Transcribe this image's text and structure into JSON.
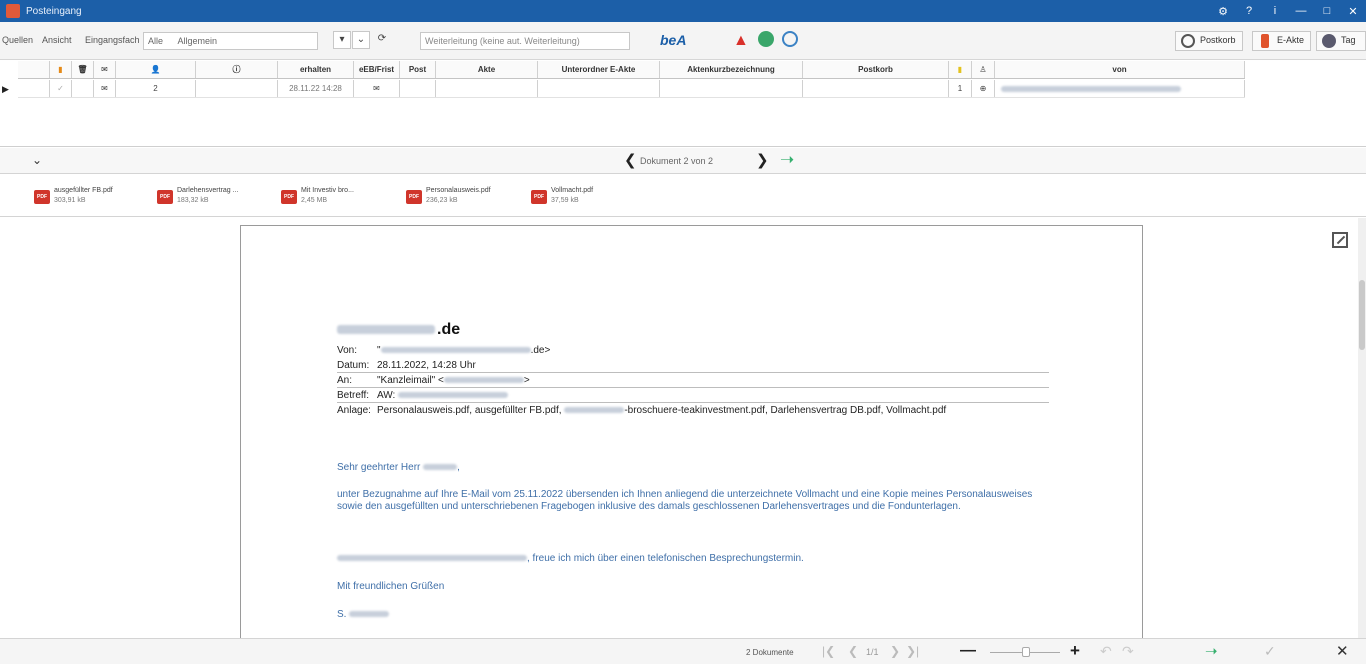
{
  "window": {
    "title": "Posteingang"
  },
  "titlebar_buttons": [
    "⚙",
    "?",
    "i",
    "—",
    "□",
    "✕"
  ],
  "toolbar": {
    "quellen": "Quellen",
    "ansicht": "Ansicht",
    "eingangsfach": "Eingangsfach",
    "fach_value": "Alle",
    "fach_select": "Allgemein",
    "weiterleitung": "Weiterleitung (keine aut. Weiterleitung)",
    "bea": "beA",
    "postkorb": "Postkorb",
    "eakte": "E-Akte",
    "tag": "Tag"
  },
  "grid": {
    "headers": [
      "",
      "",
      "",
      "",
      "",
      "erhalten",
      "eEB/Frist",
      "Post",
      "Akte",
      "Unterordner E-Akte",
      "Aktenkurzbezeichnung",
      "Postkorb",
      "",
      "",
      "von"
    ],
    "row": [
      "",
      "✓",
      "",
      "✉",
      "2",
      "",
      "28.11.22 14:28",
      "✉",
      "",
      "",
      "",
      "",
      "",
      "1",
      "⊕"
    ],
    "row_marker": "▶"
  },
  "pager": {
    "collapse": "⌄",
    "prev": "❮",
    "label": "Dokument 2 von 2",
    "next": "❯",
    "forward": "➝"
  },
  "attachments": [
    {
      "name": "ausgefüllter FB.pdf",
      "size": "303,91 kB"
    },
    {
      "name": "Darlehensvertrag ...",
      "size": "183,32 kB"
    },
    {
      "name": "Mit Investiv bro...",
      "size": "2,45 MB"
    },
    {
      "name": "Personalausweis.pdf",
      "size": "236,23 kB"
    },
    {
      "name": "Vollmacht.pdf",
      "size": "37,59 kB"
    }
  ],
  "attachment_icon": "PDF",
  "email": {
    "domain": ".de",
    "header_rows": [
      {
        "key": "Von:",
        "value_pre": "\"",
        "value_post": ".de>"
      },
      {
        "key": "Datum:",
        "value_pre": "28.11.2022, 14:28 Uhr",
        "value_post": ""
      },
      {
        "key": "An:",
        "value_pre": "\"Kanzleimail\" <",
        "value_post": ">"
      },
      {
        "key": "Betreff:",
        "value_pre": "AW:",
        "value_post": ""
      },
      {
        "key": "Anlage:",
        "value_pre": "Personalausweis.pdf, ausgefüllter FB.pdf,",
        "value_post": "-broschuere-teakinvestment.pdf, Darlehensvertrag DB.pdf, Vollmacht.pdf"
      }
    ],
    "salutation": "Sehr geehrter Herr",
    "para1": "unter Bezugnahme auf Ihre E-Mail vom 25.11.2022 übersenden ich Ihnen anliegend die unterzeichnete Vollmacht und eine Kopie meines Personalausweises sowie den ausgefüllten und unterschriebenen Fragebogen inklusive des damals geschlossenen Darlehensvertrages und die Fondunterlagen.",
    "para2": ", freue ich mich über einen telefonischen Besprechungstermin.",
    "closing": "Mit freundlichen Grüßen",
    "signature": "S."
  },
  "statusbar": {
    "doc_count": "2 Dokumente",
    "first": "|❮",
    "prev": "❮",
    "page": "1/1",
    "next": "❯",
    "last": "❯|",
    "zoom_out": "—",
    "zoom_in": "+",
    "rotate_left": "↶",
    "rotate_right": "↷",
    "forward": "➝",
    "accept": "✓",
    "close": "✕"
  }
}
